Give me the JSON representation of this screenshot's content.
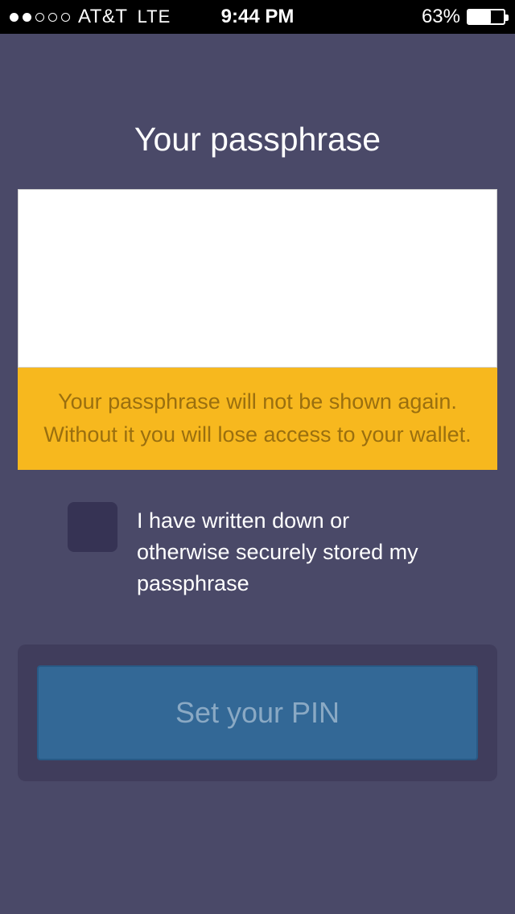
{
  "status": {
    "carrier": "AT&T",
    "network": "LTE",
    "time": "9:44 PM",
    "battery_pct": "63%"
  },
  "page": {
    "title": "Your passphrase",
    "warning_line1": "Your passphrase will not be shown again.",
    "warning_line2": "Without it you will lose access to your wallet."
  },
  "confirm": {
    "label": "I have written down or otherwise securely stored my passphrase",
    "checked": false
  },
  "cta": {
    "label": "Set your PIN"
  }
}
